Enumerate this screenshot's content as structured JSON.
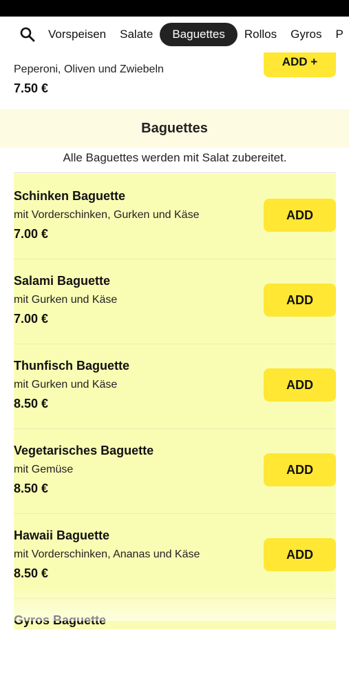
{
  "nav": {
    "tabs": [
      {
        "label": "Vorspeisen"
      },
      {
        "label": "Salate"
      },
      {
        "label": "Baguettes"
      },
      {
        "label": "Rollos"
      },
      {
        "label": "Gyros"
      },
      {
        "label": "P"
      }
    ],
    "active_index": 2,
    "search_icon": "search-icon"
  },
  "previous_item": {
    "description": "Peperoni, Oliven und Zwiebeln",
    "price": "7.50 €",
    "button_label": "ADD +"
  },
  "section": {
    "title": "Baguettes",
    "note": "Alle Baguettes werden mit Salat zubereitet."
  },
  "items": [
    {
      "name": "Schinken Baguette",
      "description": "mit Vorderschinken, Gurken und Käse",
      "price": "7.00 €",
      "button": "ADD"
    },
    {
      "name": "Salami Baguette",
      "description": "mit Gurken und Käse",
      "price": "7.00 €",
      "button": "ADD"
    },
    {
      "name": "Thunfisch Baguette",
      "description": "mit Gurken und Käse",
      "price": "8.50 €",
      "button": "ADD"
    },
    {
      "name": "Vegetarisches Baguette",
      "description": "mit Gemüse",
      "price": "8.50 €",
      "button": "ADD"
    },
    {
      "name": "Hawaii Baguette",
      "description": "mit Vorderschinken, Ananas und Käse",
      "price": "8.50 €",
      "button": "ADD"
    },
    {
      "name": "Gyros Baguette",
      "description": "",
      "price": "",
      "button": ""
    }
  ],
  "colors": {
    "accent_button": "#ffe733",
    "list_background": "#f9fdb4",
    "section_header_background": "#fefbe3",
    "active_tab": "#222222"
  }
}
